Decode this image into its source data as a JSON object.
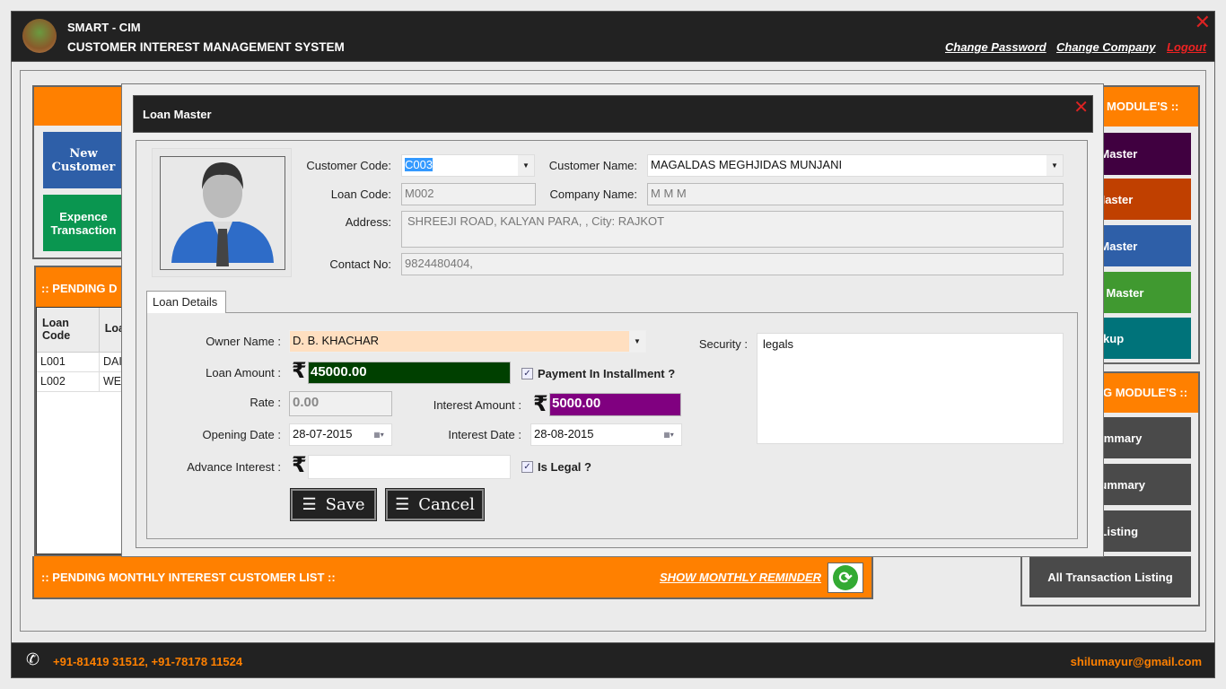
{
  "app": {
    "title": "SMART - CIM",
    "subtitle": "CUSTOMER INTEREST MANAGEMENT SYSTEM",
    "links": [
      "Change Password",
      "Change Company",
      "Logout"
    ]
  },
  "left": {
    "tiles": [
      "New Customer",
      "Expence Transaction"
    ],
    "pending_header": ":: PENDING D",
    "table": {
      "headers": [
        "Loan Code",
        "Loa"
      ],
      "rows": [
        [
          "L001",
          "DAI"
        ],
        [
          "L002",
          "WEI"
        ]
      ]
    },
    "monthly_header": ":: PENDING MONTHLY INTEREST CUSTOMER LIST ::",
    "reminder_link": "SHOW MONTHLY REMINDER"
  },
  "right": {
    "master_header": "MODULE'S ::",
    "masters": [
      "ny Master",
      "r Master",
      "pe Master",
      "Type Master",
      "ckup"
    ],
    "report_header": "G MODULE'S ::",
    "reports": [
      "n Summary",
      "an Summary",
      "on Listing",
      "All Transaction Listing"
    ]
  },
  "footer": {
    "phone": "+91-81419 31512, +91-78178 11524",
    "email": "shilumayur@gmail.com"
  },
  "modal": {
    "title": "Loan Master",
    "customer_code_label": "Customer Code:",
    "customer_code": "C003",
    "customer_name_label": "Customer Name:",
    "customer_name": "MAGALDAS MEGHJIDAS MUNJANI",
    "loan_code_label": "Loan Code:",
    "loan_code": "M002",
    "company_name_label": "Company Name:",
    "company_name": "M M M",
    "address_label": "Address:",
    "address": "SHREEJI ROAD, KALYAN PARA, , City: RAJKOT",
    "contact_label": "Contact No:",
    "contact": "9824480404,",
    "tab": "Loan Details",
    "owner_label": "Owner Name :",
    "owner": "D. B. KHACHAR",
    "loan_amount_label": "Loan Amount :",
    "loan_amount": "45000.00",
    "installment_label": "Payment In Installment ?",
    "installment_checked": true,
    "rate_label": "Rate :",
    "rate": "0.00",
    "interest_amount_label": "Interest Amount :",
    "interest_amount": "5000.00",
    "opening_date_label": "Opening Date :",
    "opening_date": "28-07-2015",
    "interest_date_label": "Interest Date :",
    "interest_date": "28-08-2015",
    "advance_label": "Advance Interest :",
    "advance": "",
    "legal_label": "Is Legal ?",
    "legal_checked": true,
    "security_label": "Security :",
    "security": "legals",
    "save": "Save",
    "cancel": "Cancel",
    "rupee": "₹"
  },
  "colors": {
    "orange": "#ff8000",
    "loan_amount_bg": "#004000",
    "interest_bg": "#800080",
    "owner_bg": "#ffdfc0"
  }
}
